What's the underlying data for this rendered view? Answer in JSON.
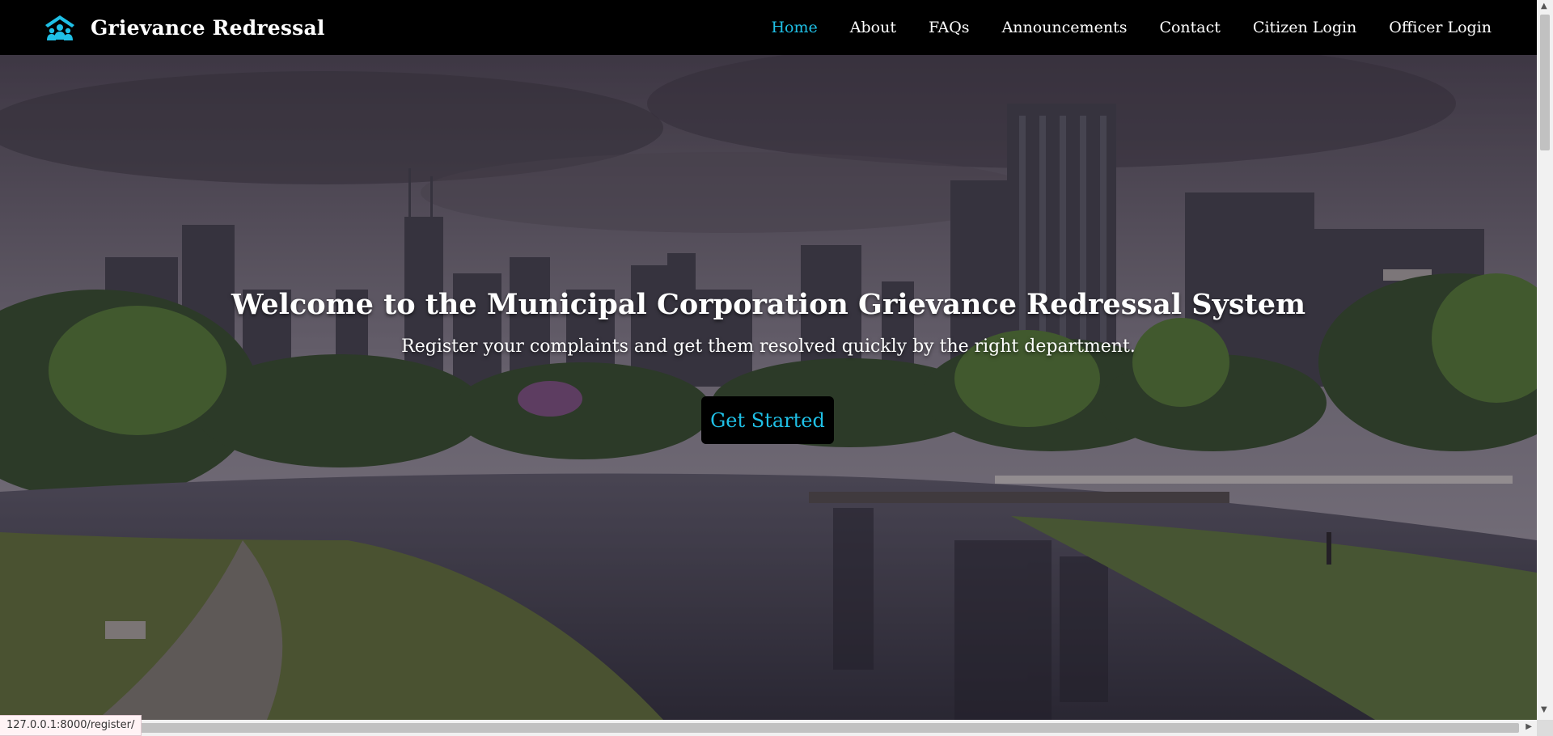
{
  "brand": {
    "title": "Grievance Redressal",
    "icon": "people-house-icon",
    "accent": "#1fc0e6"
  },
  "nav": {
    "items": [
      {
        "label": "Home",
        "active": true
      },
      {
        "label": "About"
      },
      {
        "label": "FAQs"
      },
      {
        "label": "Announcements"
      },
      {
        "label": "Contact"
      },
      {
        "label": "Citizen Login"
      },
      {
        "label": "Officer Login"
      }
    ]
  },
  "hero": {
    "title": "Welcome to the Municipal Corporation Grievance Redressal System",
    "subtitle": "Register your complaints and get them resolved quickly by the right department.",
    "cta_label": "Get Started",
    "background": "city-park-lake-skyline-photo"
  },
  "status_bar": {
    "url": "127.0.0.1:8000/register/"
  }
}
